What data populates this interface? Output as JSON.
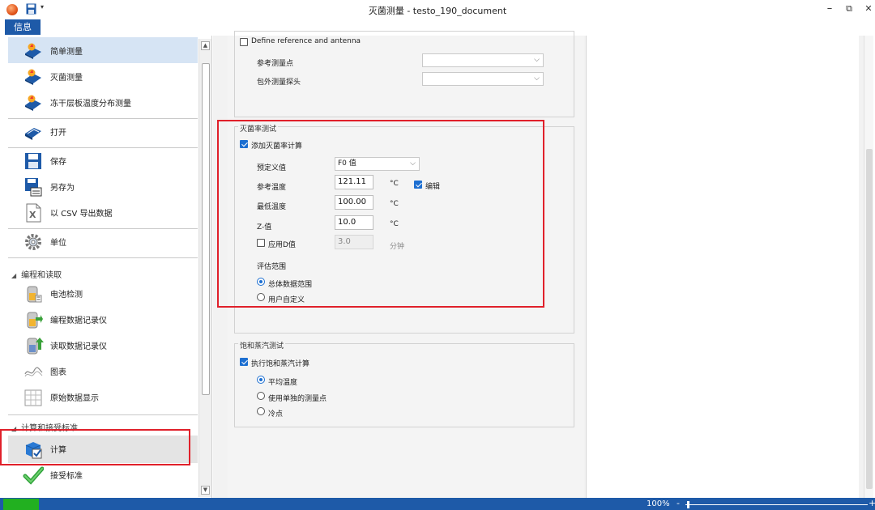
{
  "window": {
    "title": "灭菌测量 - testo_190_document",
    "minimize": "–",
    "restore": "⧉",
    "close": "✕",
    "qa_dropdown": "▾"
  },
  "ribbon": {
    "tab_info": "信息"
  },
  "nav": {
    "items": [
      {
        "label": "简单测量"
      },
      {
        "label": "灭菌测量"
      },
      {
        "label": "冻干层板温度分布测量"
      },
      {
        "label": "打开"
      },
      {
        "label": "保存"
      },
      {
        "label": "另存为"
      },
      {
        "label": "以 CSV 导出数据"
      },
      {
        "label": "单位"
      },
      {
        "label": "电池检测"
      },
      {
        "label": "编程数据记录仪"
      },
      {
        "label": "读取数据记录仪"
      },
      {
        "label": "图表"
      },
      {
        "label": "原始数据显示"
      },
      {
        "label": "计算"
      },
      {
        "label": "接受标准"
      }
    ],
    "groups": {
      "programming": "编程和读取",
      "calc": "计算和接受标准"
    },
    "group_marker": "◢"
  },
  "reference": {
    "define_label": "Define reference and antenna",
    "ref_point_label": "参考测量点",
    "ext_probe_label": "包外测量探头"
  },
  "lethality": {
    "legend": "灭菌率测试",
    "add_calc_label": "添加灭菌率计算",
    "predefined_label": "预定义值",
    "predefined_value": "F0 值",
    "ref_temp_label": "参考温度",
    "ref_temp_value": "121.11",
    "unit_c": "°C",
    "edit_label": "编辑",
    "min_temp_label": "最低温度",
    "min_temp_value": "100.00",
    "z_label": "Z-值",
    "z_value": "10.0",
    "apply_d_label": "应用D值",
    "d_value": "3.0",
    "minutes_label": "分钟",
    "eval_range_label": "评估范围",
    "range_all_label": "总体数据范围",
    "range_user_label": "用户自定义"
  },
  "saturated": {
    "legend": "饱和蒸汽测试",
    "exec_label": "执行饱和蒸汽计算",
    "avg_temp_label": "平均温度",
    "single_point_label": "使用单独的测量点",
    "cold_point_label": "冷点"
  },
  "status": {
    "zoom": "100%",
    "zoom_minus": "-",
    "zoom_plus": "+"
  },
  "colors": {
    "accent": "#1e5aa8",
    "highlight": "#e0202a",
    "status_green": "#22b020"
  }
}
